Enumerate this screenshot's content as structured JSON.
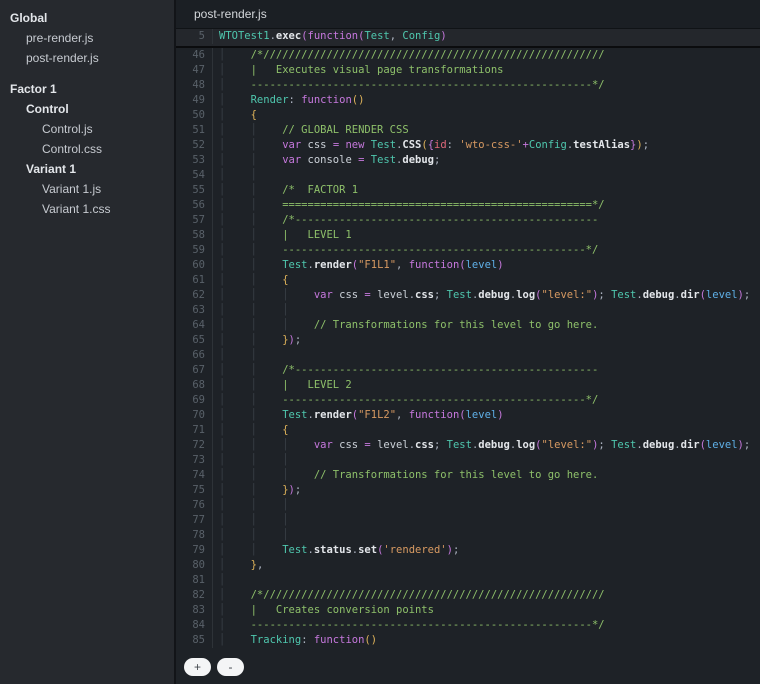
{
  "palette": {
    "editor_bg": "#1e2227",
    "sidebar_bg": "#26292e",
    "tabbar_bg": "#1b1f24",
    "comment_green": "#8ec06a",
    "keyword_pink": "#c678dd",
    "identifier_teal": "#4fc7ae",
    "string_orange": "#d89a62",
    "brace_gold": "#dfb35a",
    "param_blue": "#5fb0e8",
    "line_number_gray": "#596169"
  },
  "sidebar": {
    "items": [
      {
        "label": "Global",
        "level": 0,
        "bold": true,
        "gap": false
      },
      {
        "label": "pre-render.js",
        "level": 1,
        "bold": false,
        "gap": false
      },
      {
        "label": "post-render.js",
        "level": 1,
        "bold": false,
        "gap": false
      },
      {
        "label": "Factor 1",
        "level": 0,
        "bold": true,
        "gap": true
      },
      {
        "label": "Control",
        "level": 1,
        "bold": true,
        "gap": false
      },
      {
        "label": "Control.js",
        "level": 2,
        "bold": false,
        "gap": false
      },
      {
        "label": "Control.css",
        "level": 2,
        "bold": false,
        "gap": false
      },
      {
        "label": "Variant 1",
        "level": 1,
        "bold": true,
        "gap": false
      },
      {
        "label": "Variant 1.js",
        "level": 2,
        "bold": false,
        "gap": false
      },
      {
        "label": "Variant 1.css",
        "level": 2,
        "bold": false,
        "gap": false
      }
    ]
  },
  "editor": {
    "tab": "post-render.js",
    "sticky_line": {
      "n": 5,
      "g": 0,
      "t": [
        [
          "i",
          "WTOTest1"
        ],
        [
          "x",
          "."
        ],
        [
          "m",
          "exec"
        ],
        [
          "q",
          "("
        ],
        [
          "k",
          "function"
        ],
        [
          "q",
          "("
        ],
        [
          "i",
          "Test"
        ],
        [
          "x",
          ", "
        ],
        [
          "i",
          "Config"
        ],
        [
          "q",
          ")"
        ]
      ]
    },
    "lines": [
      {
        "n": 46,
        "g": 1,
        "t": [
          [
            "c",
            "/*//////////////////////////////////////////////////////"
          ]
        ]
      },
      {
        "n": 47,
        "g": 1,
        "t": [
          [
            "c",
            "|   Executes visual page transformations"
          ]
        ]
      },
      {
        "n": 48,
        "g": 1,
        "t": [
          [
            "c",
            "------------------------------------------------------*/"
          ]
        ]
      },
      {
        "n": 49,
        "g": 1,
        "t": [
          [
            "i",
            "Render"
          ],
          [
            "x",
            ": "
          ],
          [
            "k",
            "function"
          ],
          [
            "b",
            "()"
          ]
        ]
      },
      {
        "n": 50,
        "g": 1,
        "t": [
          [
            "b",
            "{"
          ]
        ]
      },
      {
        "n": 51,
        "g": 2,
        "t": [
          [
            "c",
            "// GLOBAL RENDER CSS"
          ]
        ]
      },
      {
        "n": 52,
        "g": 2,
        "t": [
          [
            "k",
            "var "
          ],
          [
            "v",
            "css "
          ],
          [
            "o",
            "= "
          ],
          [
            "k",
            "new "
          ],
          [
            "i",
            "Test"
          ],
          [
            "x",
            "."
          ],
          [
            "m",
            "CSS"
          ],
          [
            "b",
            "("
          ],
          [
            "q",
            "{"
          ],
          [
            "y",
            "id"
          ],
          [
            "x",
            ": "
          ],
          [
            "s",
            "'wto-css-'"
          ],
          [
            "o",
            "+"
          ],
          [
            "i",
            "Config"
          ],
          [
            "x",
            "."
          ],
          [
            "m",
            "testAlias"
          ],
          [
            "q",
            "}"
          ],
          [
            "b",
            ")"
          ],
          [
            "x",
            ";"
          ]
        ]
      },
      {
        "n": 53,
        "g": 2,
        "t": [
          [
            "k",
            "var "
          ],
          [
            "v",
            "console "
          ],
          [
            "o",
            "= "
          ],
          [
            "i",
            "Test"
          ],
          [
            "x",
            "."
          ],
          [
            "m",
            "debug"
          ],
          [
            "x",
            ";"
          ]
        ]
      },
      {
        "n": 54,
        "g": 2,
        "t": []
      },
      {
        "n": 55,
        "g": 2,
        "t": [
          [
            "c",
            "/*  FACTOR 1"
          ]
        ]
      },
      {
        "n": 56,
        "g": 2,
        "t": [
          [
            "c",
            "=================================================*/"
          ]
        ]
      },
      {
        "n": 57,
        "g": 2,
        "t": [
          [
            "c",
            "/*------------------------------------------------"
          ]
        ]
      },
      {
        "n": 58,
        "g": 2,
        "t": [
          [
            "c",
            "|   LEVEL 1"
          ]
        ]
      },
      {
        "n": 59,
        "g": 2,
        "t": [
          [
            "c",
            "------------------------------------------------*/"
          ]
        ]
      },
      {
        "n": 60,
        "g": 2,
        "t": [
          [
            "i",
            "Test"
          ],
          [
            "x",
            "."
          ],
          [
            "m",
            "render"
          ],
          [
            "q",
            "("
          ],
          [
            "s",
            "\"F1L1\""
          ],
          [
            "x",
            ", "
          ],
          [
            "k",
            "function"
          ],
          [
            "q",
            "("
          ],
          [
            "p",
            "level"
          ],
          [
            "q",
            ")"
          ]
        ]
      },
      {
        "n": 61,
        "g": 2,
        "t": [
          [
            "b",
            "{"
          ]
        ]
      },
      {
        "n": 62,
        "g": 3,
        "t": [
          [
            "k",
            "var "
          ],
          [
            "v",
            "css "
          ],
          [
            "o",
            "= "
          ],
          [
            "v",
            "level"
          ],
          [
            "x",
            "."
          ],
          [
            "m",
            "css"
          ],
          [
            "x",
            "; "
          ],
          [
            "i",
            "Test"
          ],
          [
            "x",
            "."
          ],
          [
            "m",
            "debug"
          ],
          [
            "x",
            "."
          ],
          [
            "m",
            "log"
          ],
          [
            "q",
            "("
          ],
          [
            "s",
            "\"level:\""
          ],
          [
            "q",
            ")"
          ],
          [
            "x",
            "; "
          ],
          [
            "i",
            "Test"
          ],
          [
            "x",
            "."
          ],
          [
            "m",
            "debug"
          ],
          [
            "x",
            "."
          ],
          [
            "m",
            "dir"
          ],
          [
            "q",
            "("
          ],
          [
            "p",
            "level"
          ],
          [
            "q",
            ")"
          ],
          [
            "x",
            ";"
          ]
        ]
      },
      {
        "n": 63,
        "g": 3,
        "t": []
      },
      {
        "n": 64,
        "g": 3,
        "t": [
          [
            "c",
            "// Transformations for this level to go here."
          ]
        ]
      },
      {
        "n": 65,
        "g": 2,
        "t": [
          [
            "b",
            "}"
          ],
          [
            "q",
            ")"
          ],
          [
            "x",
            ";"
          ]
        ]
      },
      {
        "n": 66,
        "g": 2,
        "t": []
      },
      {
        "n": 67,
        "g": 2,
        "t": [
          [
            "c",
            "/*------------------------------------------------"
          ]
        ]
      },
      {
        "n": 68,
        "g": 2,
        "t": [
          [
            "c",
            "|   LEVEL 2"
          ]
        ]
      },
      {
        "n": 69,
        "g": 2,
        "t": [
          [
            "c",
            "------------------------------------------------*/"
          ]
        ]
      },
      {
        "n": 70,
        "g": 2,
        "t": [
          [
            "i",
            "Test"
          ],
          [
            "x",
            "."
          ],
          [
            "m",
            "render"
          ],
          [
            "q",
            "("
          ],
          [
            "s",
            "\"F1L2\""
          ],
          [
            "x",
            ", "
          ],
          [
            "k",
            "function"
          ],
          [
            "q",
            "("
          ],
          [
            "p",
            "level"
          ],
          [
            "q",
            ")"
          ]
        ]
      },
      {
        "n": 71,
        "g": 2,
        "t": [
          [
            "b",
            "{"
          ]
        ]
      },
      {
        "n": 72,
        "g": 3,
        "t": [
          [
            "k",
            "var "
          ],
          [
            "v",
            "css "
          ],
          [
            "o",
            "= "
          ],
          [
            "v",
            "level"
          ],
          [
            "x",
            "."
          ],
          [
            "m",
            "css"
          ],
          [
            "x",
            "; "
          ],
          [
            "i",
            "Test"
          ],
          [
            "x",
            "."
          ],
          [
            "m",
            "debug"
          ],
          [
            "x",
            "."
          ],
          [
            "m",
            "log"
          ],
          [
            "q",
            "("
          ],
          [
            "s",
            "\"level:\""
          ],
          [
            "q",
            ")"
          ],
          [
            "x",
            "; "
          ],
          [
            "i",
            "Test"
          ],
          [
            "x",
            "."
          ],
          [
            "m",
            "debug"
          ],
          [
            "x",
            "."
          ],
          [
            "m",
            "dir"
          ],
          [
            "q",
            "("
          ],
          [
            "p",
            "level"
          ],
          [
            "q",
            ")"
          ],
          [
            "x",
            ";"
          ]
        ]
      },
      {
        "n": 73,
        "g": 3,
        "t": []
      },
      {
        "n": 74,
        "g": 3,
        "t": [
          [
            "c",
            "// Transformations for this level to go here."
          ]
        ]
      },
      {
        "n": 75,
        "g": 2,
        "t": [
          [
            "b",
            "}"
          ],
          [
            "q",
            ")"
          ],
          [
            "x",
            ";"
          ]
        ]
      },
      {
        "n": 76,
        "g": 3,
        "t": []
      },
      {
        "n": 77,
        "g": 3,
        "t": []
      },
      {
        "n": 78,
        "g": 3,
        "t": []
      },
      {
        "n": 79,
        "g": 2,
        "t": [
          [
            "i",
            "Test"
          ],
          [
            "x",
            "."
          ],
          [
            "m",
            "status"
          ],
          [
            "x",
            "."
          ],
          [
            "m",
            "set"
          ],
          [
            "q",
            "("
          ],
          [
            "s",
            "'rendered'"
          ],
          [
            "q",
            ")"
          ],
          [
            "x",
            ";"
          ]
        ]
      },
      {
        "n": 80,
        "g": 1,
        "t": [
          [
            "b",
            "}"
          ],
          [
            "x",
            ","
          ]
        ]
      },
      {
        "n": 81,
        "g": 1,
        "t": []
      },
      {
        "n": 82,
        "g": 1,
        "t": [
          [
            "c",
            "/*//////////////////////////////////////////////////////"
          ]
        ]
      },
      {
        "n": 83,
        "g": 1,
        "t": [
          [
            "c",
            "|   Creates conversion points"
          ]
        ]
      },
      {
        "n": 84,
        "g": 1,
        "t": [
          [
            "c",
            "------------------------------------------------------*/"
          ]
        ]
      },
      {
        "n": 85,
        "g": 1,
        "t": [
          [
            "i",
            "Tracking"
          ],
          [
            "x",
            ": "
          ],
          [
            "k",
            "function"
          ],
          [
            "b",
            "()"
          ]
        ]
      }
    ]
  },
  "zoom_controls": {
    "zoom_in": "+",
    "zoom_out": "-"
  }
}
